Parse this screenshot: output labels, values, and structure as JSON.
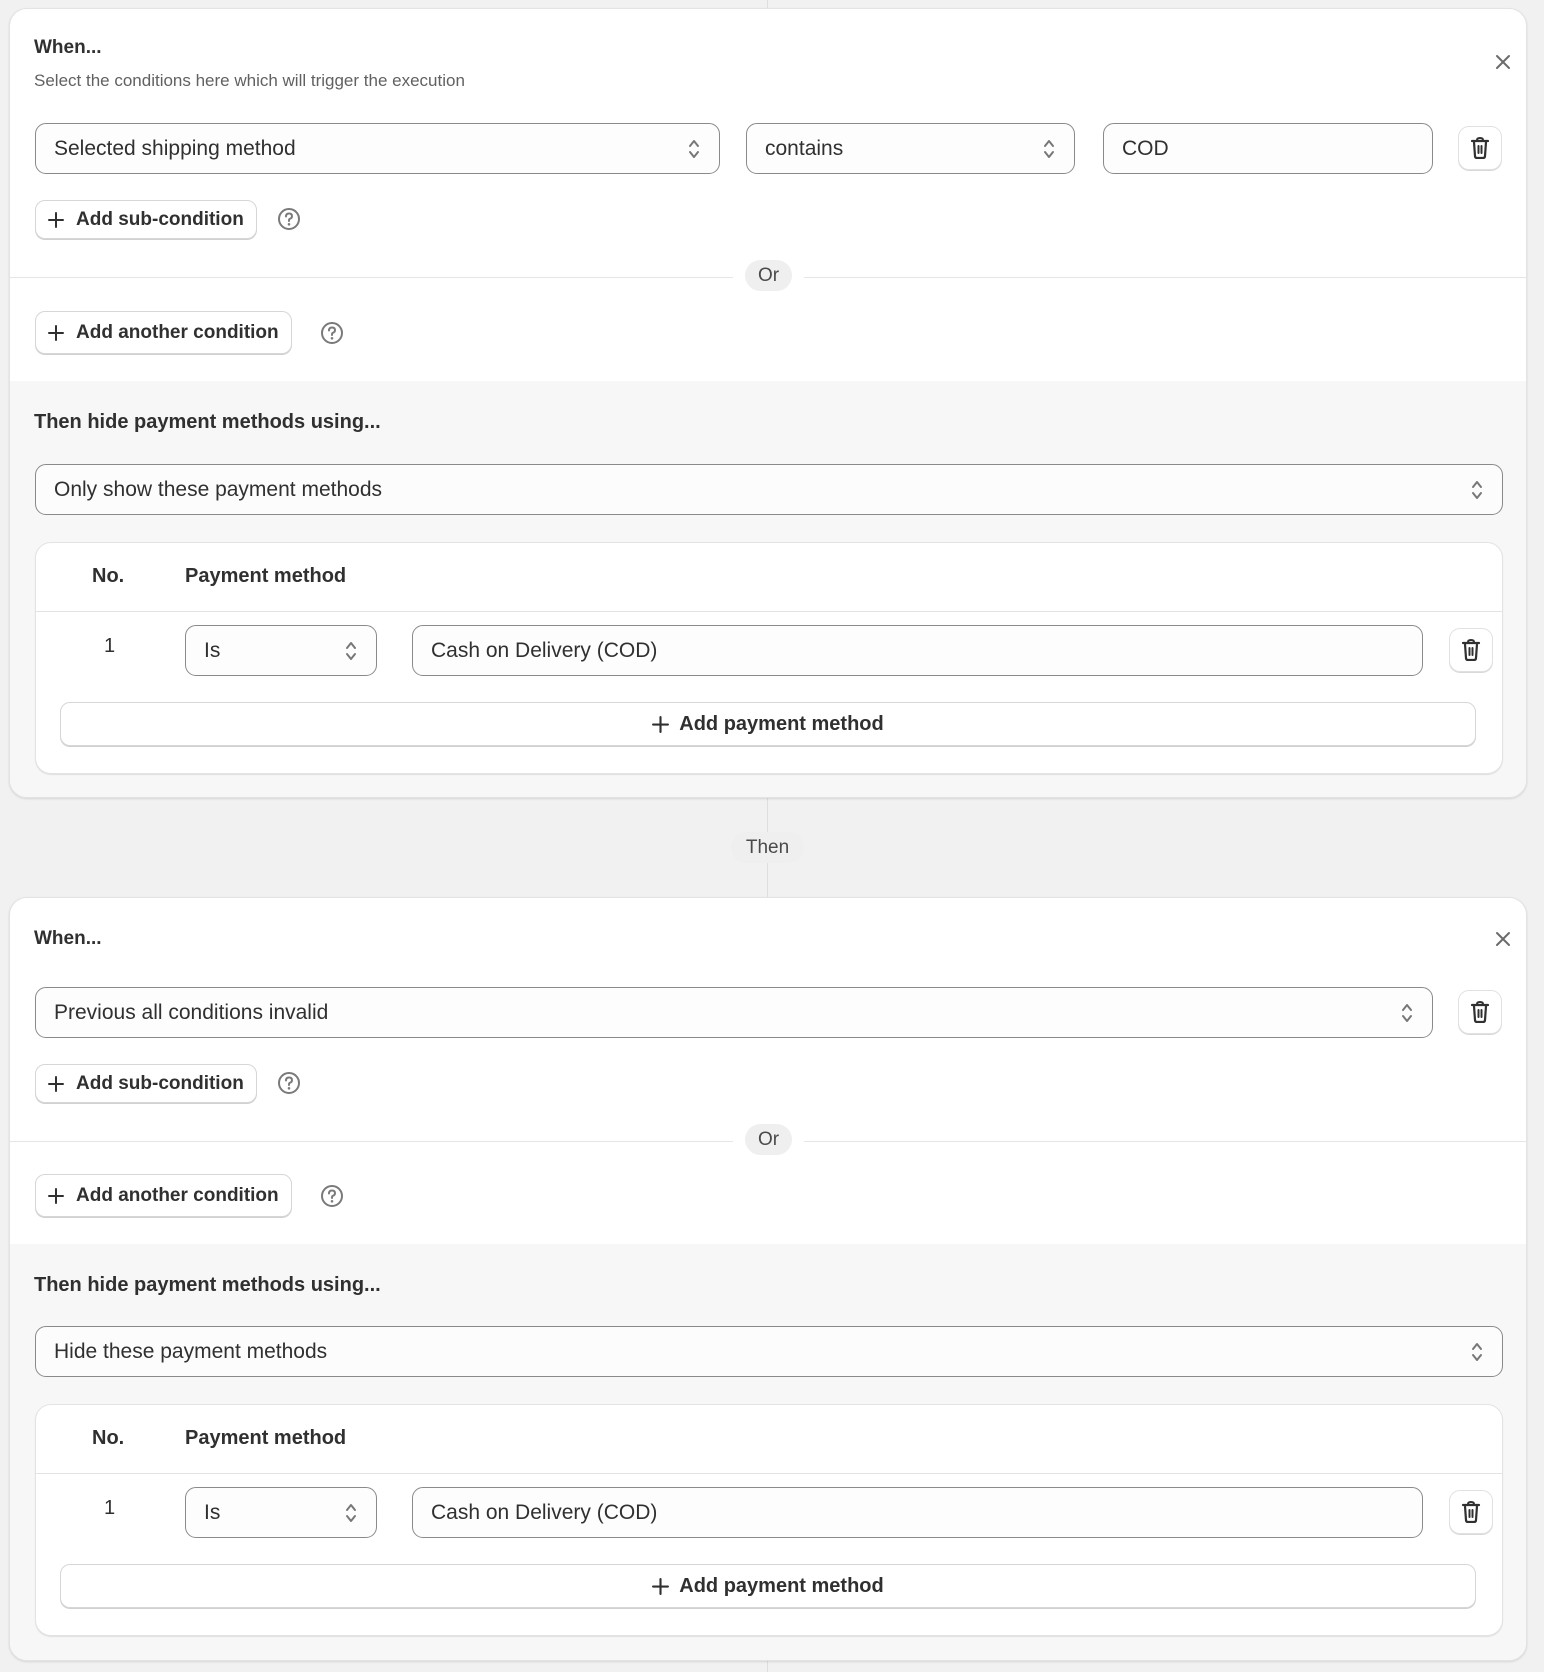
{
  "flow": {
    "connector_label": "Then",
    "rules": [
      {
        "when_title": "When...",
        "when_subtitle": "Select the conditions here which will trigger the execution",
        "close_icon": "close-icon",
        "condition": {
          "field": "Selected shipping method",
          "operator": "contains",
          "value": "COD",
          "delete_icon": "trash-icon"
        },
        "add_sub_condition_label": "Add sub-condition",
        "or_label": "Or",
        "add_another_condition_label": "Add another condition",
        "help_icon": "question-circle-icon",
        "then_title": "Then hide payment methods using...",
        "mode": "Only show these payment methods",
        "table": {
          "columns": [
            "No.",
            "Payment method"
          ],
          "rows": [
            {
              "no": "1",
              "operator": "Is",
              "method": "Cash on Delivery (COD)"
            }
          ],
          "add_label": "Add payment method"
        }
      },
      {
        "when_title": "When...",
        "close_icon": "close-icon",
        "condition": {
          "field": "Previous all conditions invalid",
          "delete_icon": "trash-icon"
        },
        "add_sub_condition_label": "Add sub-condition",
        "or_label": "Or",
        "add_another_condition_label": "Add another condition",
        "help_icon": "question-circle-icon",
        "then_title": "Then hide payment methods using...",
        "mode": "Hide these payment methods",
        "table": {
          "columns": [
            "No.",
            "Payment method"
          ],
          "rows": [
            {
              "no": "1",
              "operator": "Is",
              "method": "Cash on Delivery (COD)"
            }
          ],
          "add_label": "Add payment method"
        }
      }
    ]
  }
}
